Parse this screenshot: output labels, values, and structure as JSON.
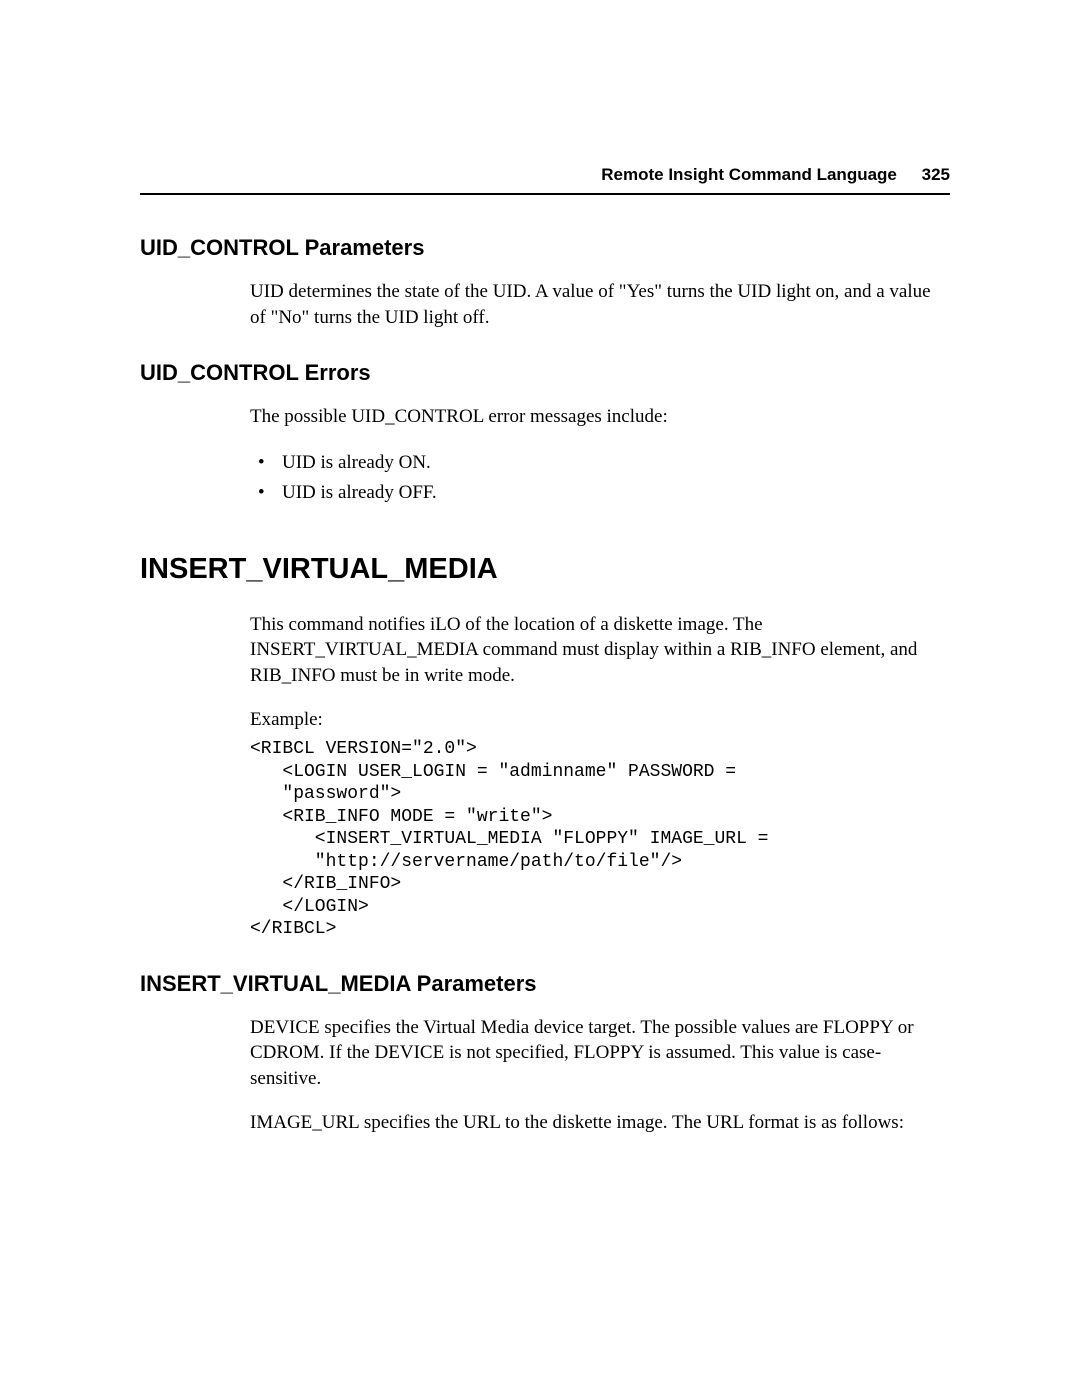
{
  "header": {
    "title": "Remote Insight Command Language",
    "page_number": "325"
  },
  "sections": {
    "uid_params": {
      "heading": "UID_CONTROL Parameters",
      "body": "UID determines the state of the UID. A value of \"Yes\" turns the UID light on, and a value of \"No\" turns the UID light off."
    },
    "uid_errors": {
      "heading": "UID_CONTROL Errors",
      "intro": "The possible UID_CONTROL error messages include:",
      "items": [
        "UID is already ON.",
        "UID is already OFF."
      ]
    },
    "ivm": {
      "heading": "INSERT_VIRTUAL_MEDIA",
      "body": "This command notifies iLO of the location of a diskette image. The INSERT_VIRTUAL_MEDIA command must display within a RIB_INFO element, and RIB_INFO must be in write mode.",
      "example_label": "Example:",
      "code": "<RIBCL VERSION=\"2.0\">\n   <LOGIN USER_LOGIN = \"adminname\" PASSWORD = \n   \"password\">\n   <RIB_INFO MODE = \"write\">\n      <INSERT_VIRTUAL_MEDIA \"FLOPPY\" IMAGE_URL = \n      \"http://servername/path/to/file\"/>\n   </RIB_INFO>\n   </LOGIN>\n</RIBCL>"
    },
    "ivm_params": {
      "heading": "INSERT_VIRTUAL_MEDIA Parameters",
      "p1": "DEVICE specifies the Virtual Media device target.  The possible values are FLOPPY or CDROM. If the DEVICE is not specified, FLOPPY is assumed. This value is case-sensitive.",
      "p2": "IMAGE_URL specifies the URL to the diskette image. The URL format is as follows:"
    }
  }
}
